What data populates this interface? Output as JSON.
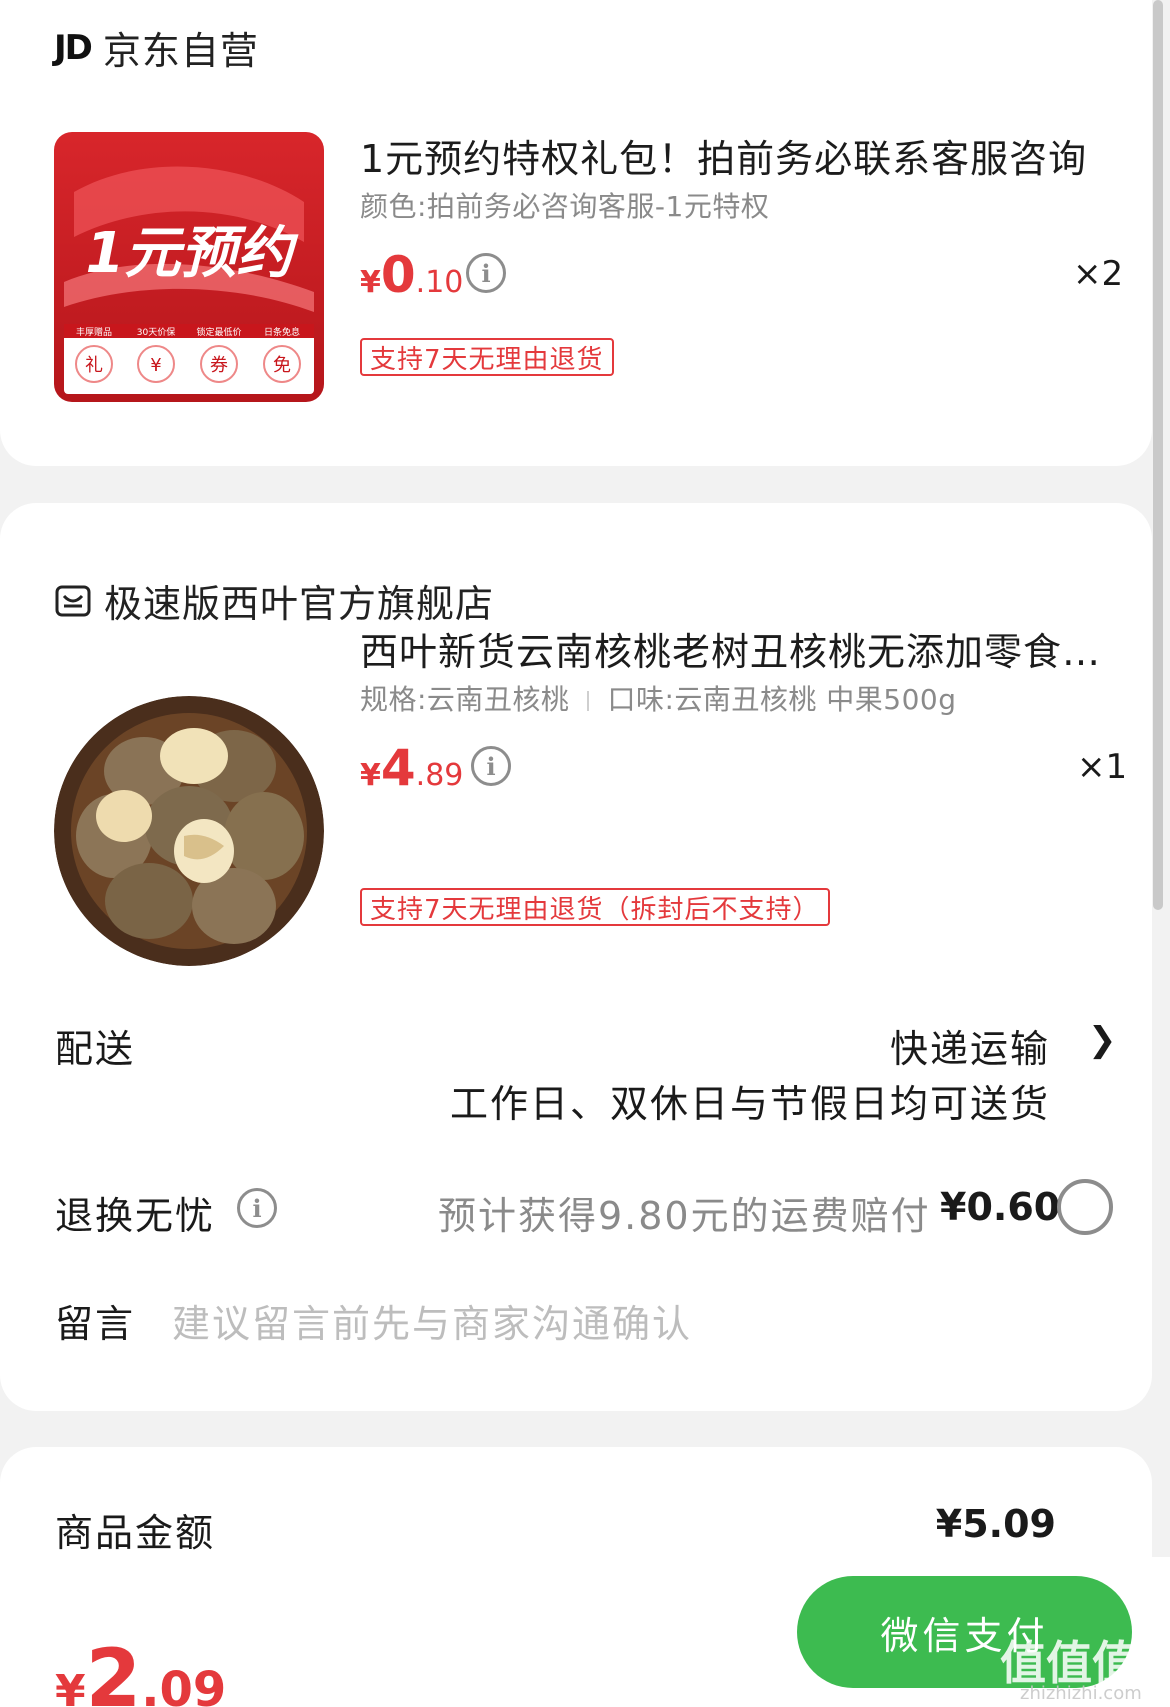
{
  "store1": {
    "logo": "JD",
    "name": "京东自营",
    "product": {
      "title": "1元预约特权礼包！拍前务必联系客服咨询",
      "spec": "颜色:拍前务必咨询客服-1元特权",
      "price_yen": "¥",
      "price_int": "0",
      "price_dec": ".10",
      "qty": "×2",
      "tag": "支持7天无理由退货",
      "image_title": "1元预约",
      "image_badges": [
        "丰厚赠品",
        "30天价保",
        "锁定最低价",
        "日条免息"
      ],
      "image_badge_icons": [
        "礼",
        "¥",
        "券",
        "免"
      ]
    }
  },
  "store2": {
    "name": "极速版西叶官方旗舰店",
    "product": {
      "title": "西叶新货云南核桃老树丑核桃无添加零食坚果",
      "spec_a": "规格:云南丑核桃",
      "spec_b": "口味:云南丑核桃 中果500g",
      "price_yen": "¥",
      "price_int": "4",
      "price_dec": ".89",
      "qty": "×1",
      "tag": "支持7天无理由退货（拆封后不支持）"
    }
  },
  "delivery": {
    "label": "配送",
    "method": "快递运输",
    "note": "工作日、双休日与节假日均可送货"
  },
  "return_insurance": {
    "label": "退换无忧",
    "desc": "预计获得9.80元的运费赔付",
    "price": "¥0.60"
  },
  "message": {
    "label": "留言",
    "placeholder": "建议留言前先与商家沟通确认"
  },
  "summary": {
    "goods_label": "商品金额",
    "goods_value": "¥5.09"
  },
  "bottom": {
    "total_yen": "¥",
    "total_int": "2",
    "total_dec": ".09",
    "pay_label": "微信支付",
    "watermark": "值值值",
    "watermark_url": "zhizhizhi.com"
  },
  "colors": {
    "accent": "#e4393c",
    "pay_green": "#3dbb50"
  }
}
